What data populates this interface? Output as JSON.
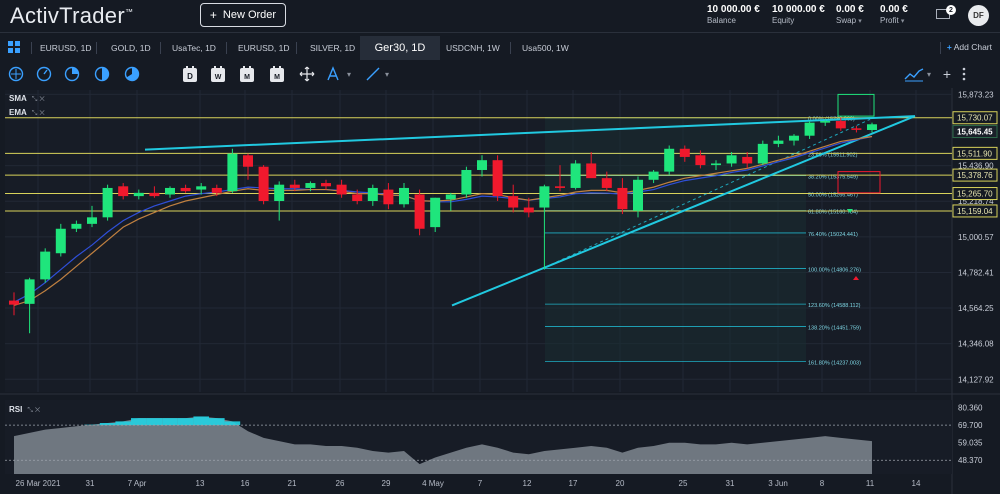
{
  "app": {
    "logo": "ActivTrader",
    "logo_mark": "™",
    "new_order": "New Order",
    "new_order_plus": "+"
  },
  "account": [
    {
      "value": "10 000.00 €",
      "label": "Balance",
      "caret": ""
    },
    {
      "value": "10 000.00 €",
      "label": "Equity",
      "caret": ""
    },
    {
      "value": "0.00 €",
      "label": "Swap",
      "caret": "▾"
    },
    {
      "value": "0.00 €",
      "label": "Profit",
      "caret": "▾"
    }
  ],
  "user": {
    "initials": "DF",
    "notifications": "2"
  },
  "tabs": [
    "EURUSD, 1D",
    "GOLD, 1D",
    "UsaTec, 1D",
    "EURUSD, 1D",
    "SILVER, 1D",
    "Ger30, 1D",
    "USDCNH, 1W",
    "Usa500, 1W"
  ],
  "active_tab": 5,
  "add_chart": "Add Chart",
  "add_chart_plus": "+",
  "toolbar_icons": [
    "crosshair-icon",
    "cycle-icon",
    "pie-icon",
    "moon-icon",
    "timer-icon",
    "day-icon",
    "week-icon",
    "month-icon",
    "crosshair-move-icon",
    "fib-arc-icon",
    "line-draw-icon",
    "trend-chart-icon",
    "settings-dots-icon"
  ],
  "period_labels": {
    "day": "D",
    "week": "W",
    "month": "M"
  },
  "indicators": {
    "sma": "SMA",
    "ema": "EMA",
    "rsi": "RSI"
  },
  "colors": {
    "bg": "#151a23",
    "bull": "#1fe57c",
    "bear": "#f0192d",
    "trend": "#21c9e0",
    "fib": "#d8d25a",
    "sma": "#2f4fd8",
    "ema": "#c08040",
    "rsi_fill": "#8e959f",
    "rsi_hi": "#22d2e2"
  },
  "chart_data": {
    "type": "candlestick",
    "symbol": "Ger30",
    "timeframe": "1D",
    "x_tick_labels": [
      "26 Mar 2021",
      "31",
      "7 Apr",
      "13",
      "16",
      "21",
      "26",
      "29",
      "4 May",
      "7",
      "12",
      "17",
      "20",
      "25",
      "31",
      "3 Jun",
      "8",
      "11",
      "14"
    ],
    "y_axis": {
      "range": [
        14050,
        15900
      ],
      "tick_labels": [
        "15,873.23",
        "15,436.90",
        "15,218.74",
        "15,000.57",
        "14,782.41",
        "14,564.25",
        "14,346.08",
        "14,127.92"
      ]
    },
    "price_tags": [
      {
        "value": 15730.07,
        "label": "15,730.07",
        "style": "yellow"
      },
      {
        "value": 15645.45,
        "label": "15,645.45",
        "style": "current"
      },
      {
        "value": 15511.9,
        "label": "15,511.90",
        "style": "yellow"
      },
      {
        "value": 15378.76,
        "label": "15,378.76",
        "style": "yellow"
      },
      {
        "value": 15265.7,
        "label": "15,265.70",
        "style": "yellow"
      },
      {
        "value": 15159.04,
        "label": "15,159.04",
        "style": "yellow"
      }
    ],
    "candles": [
      {
        "o": 14610,
        "h": 14660,
        "l": 14520,
        "c": 14585
      },
      {
        "o": 14590,
        "h": 14750,
        "l": 14410,
        "c": 14740
      },
      {
        "o": 14740,
        "h": 14930,
        "l": 14720,
        "c": 14910
      },
      {
        "o": 14900,
        "h": 15080,
        "l": 14880,
        "c": 15050
      },
      {
        "o": 15050,
        "h": 15100,
        "l": 15030,
        "c": 15080
      },
      {
        "o": 15080,
        "h": 15190,
        "l": 15060,
        "c": 15120
      },
      {
        "o": 15120,
        "h": 15320,
        "l": 15100,
        "c": 15300
      },
      {
        "o": 15310,
        "h": 15330,
        "l": 15230,
        "c": 15250
      },
      {
        "o": 15250,
        "h": 15290,
        "l": 15230,
        "c": 15270
      },
      {
        "o": 15270,
        "h": 15310,
        "l": 15240,
        "c": 15250
      },
      {
        "o": 15260,
        "h": 15310,
        "l": 15240,
        "c": 15300
      },
      {
        "o": 15300,
        "h": 15320,
        "l": 15270,
        "c": 15280
      },
      {
        "o": 15290,
        "h": 15330,
        "l": 15260,
        "c": 15310
      },
      {
        "o": 15300,
        "h": 15320,
        "l": 15250,
        "c": 15270
      },
      {
        "o": 15280,
        "h": 15540,
        "l": 15270,
        "c": 15510
      },
      {
        "o": 15500,
        "h": 15510,
        "l": 15350,
        "c": 15430
      },
      {
        "o": 15430,
        "h": 15440,
        "l": 15200,
        "c": 15220
      },
      {
        "o": 15220,
        "h": 15340,
        "l": 15100,
        "c": 15320
      },
      {
        "o": 15320,
        "h": 15350,
        "l": 15280,
        "c": 15300
      },
      {
        "o": 15300,
        "h": 15340,
        "l": 15280,
        "c": 15330
      },
      {
        "o": 15330,
        "h": 15350,
        "l": 15290,
        "c": 15310
      },
      {
        "o": 15320,
        "h": 15350,
        "l": 15240,
        "c": 15260
      },
      {
        "o": 15260,
        "h": 15290,
        "l": 15200,
        "c": 15220
      },
      {
        "o": 15220,
        "h": 15320,
        "l": 15190,
        "c": 15300
      },
      {
        "o": 15290,
        "h": 15330,
        "l": 15170,
        "c": 15200
      },
      {
        "o": 15200,
        "h": 15330,
        "l": 15180,
        "c": 15300
      },
      {
        "o": 15260,
        "h": 15290,
        "l": 15010,
        "c": 15050
      },
      {
        "o": 15060,
        "h": 15240,
        "l": 15030,
        "c": 15240
      },
      {
        "o": 15230,
        "h": 15270,
        "l": 15160,
        "c": 15260
      },
      {
        "o": 15260,
        "h": 15430,
        "l": 15240,
        "c": 15410
      },
      {
        "o": 15410,
        "h": 15500,
        "l": 15370,
        "c": 15470
      },
      {
        "o": 15470,
        "h": 15500,
        "l": 15220,
        "c": 15250
      },
      {
        "o": 15250,
        "h": 15320,
        "l": 15150,
        "c": 15180
      },
      {
        "o": 15180,
        "h": 15240,
        "l": 15120,
        "c": 15150
      },
      {
        "o": 15180,
        "h": 15320,
        "l": 14800,
        "c": 15310
      },
      {
        "o": 15310,
        "h": 15440,
        "l": 15280,
        "c": 15300
      },
      {
        "o": 15300,
        "h": 15470,
        "l": 15290,
        "c": 15450
      },
      {
        "o": 15450,
        "h": 15520,
        "l": 15390,
        "c": 15360
      },
      {
        "o": 15360,
        "h": 15400,
        "l": 15280,
        "c": 15300
      },
      {
        "o": 15300,
        "h": 15360,
        "l": 15140,
        "c": 15170
      },
      {
        "o": 15160,
        "h": 15370,
        "l": 15120,
        "c": 15350
      },
      {
        "o": 15350,
        "h": 15410,
        "l": 15330,
        "c": 15400
      },
      {
        "o": 15400,
        "h": 15560,
        "l": 15380,
        "c": 15540
      },
      {
        "o": 15540,
        "h": 15560,
        "l": 15460,
        "c": 15490
      },
      {
        "o": 15500,
        "h": 15530,
        "l": 15420,
        "c": 15440
      },
      {
        "o": 15440,
        "h": 15470,
        "l": 15410,
        "c": 15450
      },
      {
        "o": 15450,
        "h": 15520,
        "l": 15430,
        "c": 15500
      },
      {
        "o": 15490,
        "h": 15520,
        "l": 15420,
        "c": 15450
      },
      {
        "o": 15450,
        "h": 15590,
        "l": 15440,
        "c": 15570
      },
      {
        "o": 15570,
        "h": 15620,
        "l": 15550,
        "c": 15590
      },
      {
        "o": 15590,
        "h": 15630,
        "l": 15560,
        "c": 15620
      },
      {
        "o": 15620,
        "h": 15710,
        "l": 15600,
        "c": 15700
      },
      {
        "o": 15700,
        "h": 15720,
        "l": 15680,
        "c": 15710
      },
      {
        "o": 15710,
        "h": 15730,
        "l": 15650,
        "c": 15665
      },
      {
        "o": 15665,
        "h": 15680,
        "l": 15640,
        "c": 15660
      },
      {
        "o": 15655,
        "h": 15700,
        "l": 15640,
        "c": 15690
      }
    ],
    "sma": [
      14600,
      14650,
      14720,
      14800,
      14880,
      14950,
      15030,
      15100,
      15150,
      15190,
      15220,
      15250,
      15265,
      15275,
      15290,
      15305,
      15300,
      15295,
      15295,
      15290,
      15290,
      15285,
      15275,
      15270,
      15260,
      15250,
      15225,
      15215,
      15215,
      15230,
      15250,
      15245,
      15235,
      15225,
      15235,
      15245,
      15265,
      15270,
      15268,
      15262,
      15275,
      15290,
      15320,
      15345,
      15360,
      15375,
      15395,
      15410,
      15435,
      15460,
      15485,
      15515,
      15545,
      15575,
      15595,
      15615
    ],
    "ema": [
      14580,
      14610,
      14670,
      14740,
      14820,
      14900,
      14980,
      15060,
      15110,
      15150,
      15190,
      15220,
      15240,
      15260,
      15280,
      15295,
      15285,
      15285,
      15285,
      15290,
      15290,
      15280,
      15265,
      15265,
      15255,
      15255,
      15220,
      15220,
      15225,
      15245,
      15265,
      15260,
      15240,
      15225,
      15240,
      15255,
      15275,
      15285,
      15285,
      15270,
      15285,
      15305,
      15335,
      15360,
      15375,
      15390,
      15405,
      15420,
      15445,
      15470,
      15495,
      15525,
      15555,
      15585,
      15600,
      15615
    ],
    "fibonacci": [
      {
        "level": "0.00%",
        "value": 15730.07,
        "label": "0.00% (15730.069)"
      },
      {
        "level": "23.60%",
        "value": 15511.9,
        "label": "23.60% (15511.902)"
      },
      {
        "level": "38.20%",
        "value": 15375.55,
        "label": "38.20% (15375.549)"
      },
      {
        "level": "50.00%",
        "value": 15266.46,
        "label": "50.00% (15266.467)"
      },
      {
        "level": "61.80%",
        "value": 15160.78,
        "label": "61.80% (15160.784)"
      },
      {
        "level": "76.40%",
        "value": 15024.44,
        "label": "76.40% (15024.441)"
      },
      {
        "level": "100.00%",
        "value": 14806.28,
        "label": "100.00% (14806.276)"
      },
      {
        "level": "123.60%",
        "value": 14588.11,
        "label": "123.60% (14588.112)"
      },
      {
        "level": "138.20%",
        "value": 14451.76,
        "label": "138.20% (14451.759)"
      },
      {
        "level": "161.80%",
        "value": 14237.0,
        "label": "161.80% (14237.003)"
      }
    ],
    "rsi": {
      "axis_labels": [
        "80.360",
        "69.700",
        "59.035",
        "48.370"
      ],
      "range": [
        40,
        85
      ],
      "levels": [
        69.7,
        48.37
      ],
      "values": [
        63,
        65,
        67,
        68,
        69,
        70,
        71,
        72,
        74,
        74,
        74,
        74,
        75,
        74,
        72,
        66,
        62,
        60,
        58,
        58,
        57,
        57,
        56,
        54,
        53,
        54,
        46,
        50,
        53,
        56,
        58,
        56,
        53,
        52,
        54,
        55,
        56,
        57,
        56,
        53,
        56,
        57,
        59,
        59,
        58,
        58,
        59,
        58,
        59,
        60,
        61,
        62,
        63,
        62,
        61,
        60
      ]
    }
  }
}
